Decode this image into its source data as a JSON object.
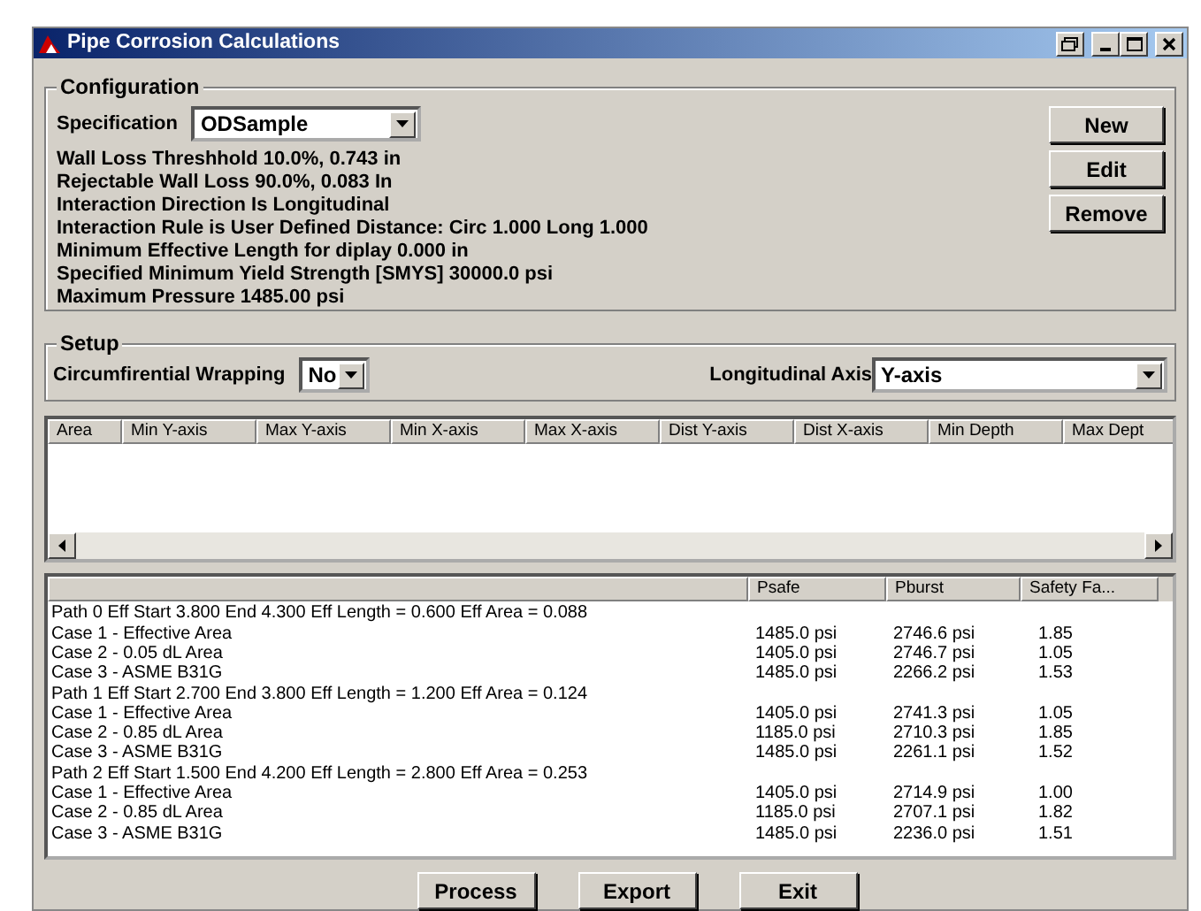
{
  "window": {
    "title": "Pipe Corrosion Calculations"
  },
  "configuration": {
    "legend": "Configuration",
    "specification_label": "Specification",
    "specification_value": "ODSample",
    "lines": [
      "Wall Loss Threshhold 10.0%, 0.743 in",
      "Rejectable Wall Loss 90.0%, 0.083 In",
      "Interaction Direction Is Longitudinal",
      "Interaction Rule is User Defined Distance: Circ 1.000 Long 1.000",
      "Minimum Effective Length for diplay 0.000 in",
      "Specified Minimum Yield Strength [SMYS] 30000.0 psi",
      "Maximum Pressure 1485.00 psi"
    ],
    "buttons": [
      "New",
      "Edit",
      "Remove"
    ]
  },
  "setup": {
    "legend": "Setup",
    "wrapping_label": "Circumfirential Wrapping",
    "wrapping_value": "No",
    "axis_label": "Longitudinal Axis",
    "axis_value": "Y-axis"
  },
  "areas_table": {
    "columns": [
      "Area",
      "Min Y-axis",
      "Max Y-axis",
      "Min X-axis",
      "Max X-axis",
      "Dist Y-axis",
      "Dist X-axis",
      "Min Depth",
      "Max Dept"
    ]
  },
  "results": {
    "columns": [
      "Psafe",
      "Pburst",
      "Safety Fa..."
    ],
    "rows": [
      {
        "kind": "path",
        "text": "Path 0 Eff Start 3.800  End 4.300  Eff Length = 0.600  Eff Area = 0.088"
      },
      {
        "kind": "case",
        "text": "Case 1 - Effective Area",
        "psafe": "1485.0 psi",
        "pburst": "2746.6 psi",
        "factor": "1.85"
      },
      {
        "kind": "case",
        "text": "Case 2 - 0.05 dL Area",
        "psafe": "1405.0 psi",
        "pburst": "2746.7 psi",
        "factor": "1.05"
      },
      {
        "kind": "case",
        "text": "Case 3 - ASME B31G",
        "psafe": "1485.0 psi",
        "pburst": "2266.2 psi",
        "factor": "1.53"
      },
      {
        "kind": "path",
        "text": "Path 1 Eff Start 2.700  End 3.800  Eff Length = 1.200  Eff Area = 0.124"
      },
      {
        "kind": "case",
        "text": "Case 1 - Effective Area",
        "psafe": "1405.0 psi",
        "pburst": "2741.3 psi",
        "factor": "1.05"
      },
      {
        "kind": "case",
        "text": "Case 2 - 0.85 dL Area",
        "psafe": "1185.0 psi",
        "pburst": "2710.3 psi",
        "factor": "1.85"
      },
      {
        "kind": "case",
        "text": "Case 3 - ASME B31G",
        "psafe": "1485.0 psi",
        "pburst": "2261.1 psi",
        "factor": "1.52"
      },
      {
        "kind": "path",
        "text": "Path 2 Eff Start 1.500  End 4.200  Eff Length = 2.800  Eff Area = 0.253"
      },
      {
        "kind": "case",
        "text": "Case 1 - Effective Area",
        "psafe": "1405.0 psi",
        "pburst": "2714.9 psi",
        "factor": "1.00"
      },
      {
        "kind": "case",
        "text": "Case 2 - 0.85 dL Area",
        "psafe": "1185.0 psi",
        "pburst": "2707.1 psi",
        "factor": "1.82"
      },
      {
        "kind": "case",
        "text": "Case 3 - ASME B31G",
        "psafe": "1485.0 psi",
        "pburst": "2236.0 psi",
        "factor": "1.51"
      }
    ]
  },
  "footer_buttons": [
    "Process",
    "Export",
    "Exit"
  ]
}
